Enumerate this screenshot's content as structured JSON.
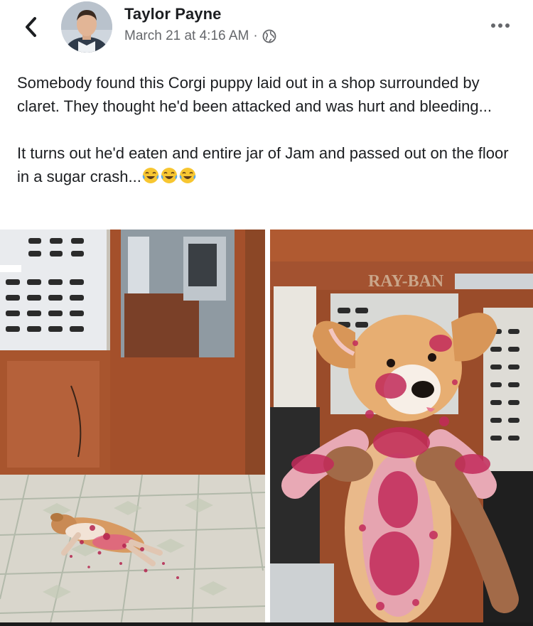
{
  "post": {
    "author": "Taylor Payne",
    "timestamp": "March 21 at 4:16 AM",
    "separator": "·",
    "privacy_icon": "globe-icon",
    "body": [
      "Somebody found this Corgi puppy laid out in a shop surrounded by claret. They thought he'd been attacked and was hurt and bleeding...",
      "It turns out he'd eaten and entire jar of Jam and passed out on the floor in a sugar crash..."
    ],
    "emoji": [
      "face-with-tears-of-joy",
      "face-with-tears-of-joy",
      "face-with-tears-of-joy"
    ]
  },
  "nav": {
    "back_icon": "chevron-left-icon",
    "more_icon": "ellipsis-icon"
  },
  "photos": [
    {
      "subject": "puppy lying on tiled shop floor covered in jam"
    },
    {
      "subject": "puppy held up covered in jam",
      "sign_text": "RAY-BAN"
    }
  ],
  "colors": {
    "text": "#1c1e21",
    "secondary": "#65676b",
    "jam": "#c22a5a",
    "wood": "#a8552e"
  }
}
